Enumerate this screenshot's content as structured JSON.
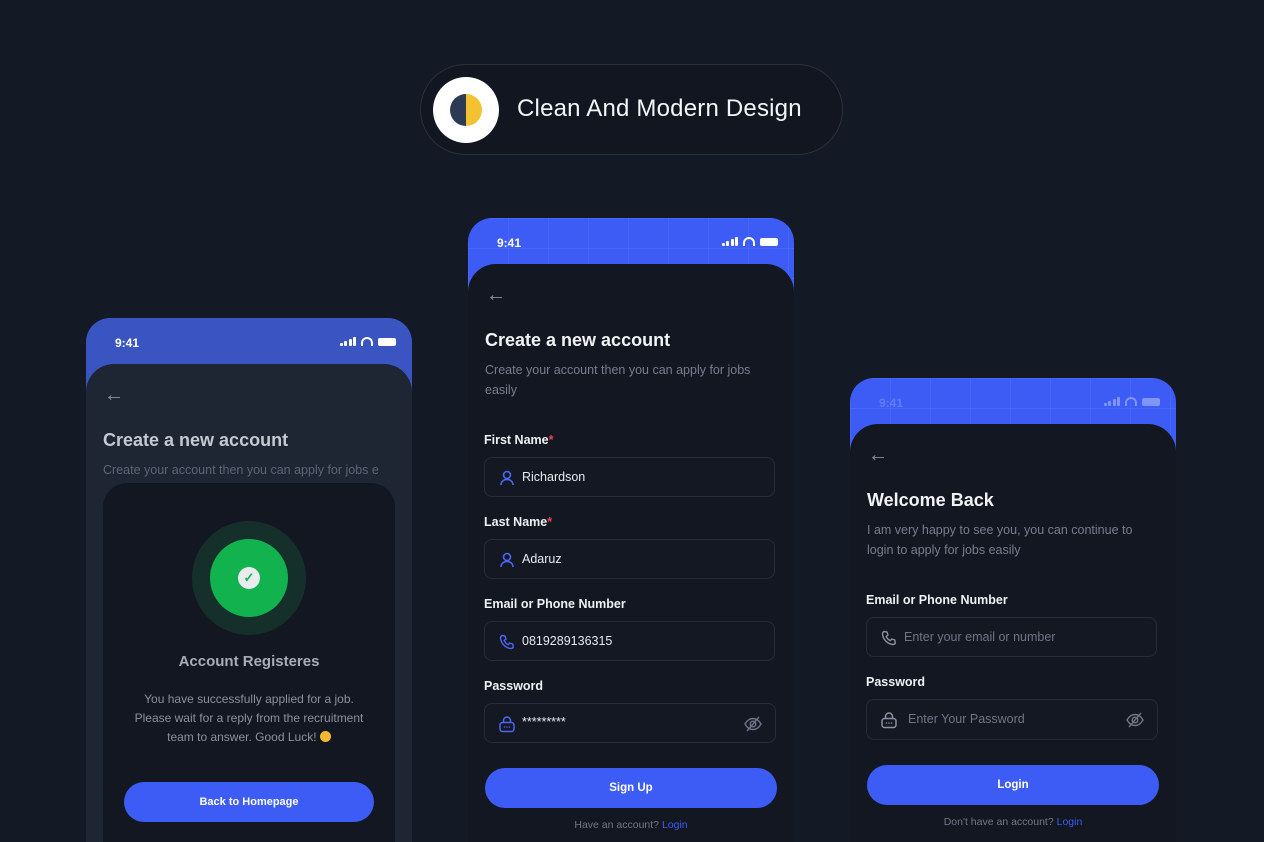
{
  "banner": {
    "title": "Clean And Modern Design",
    "logo_icon": "half-moon-icon"
  },
  "colors": {
    "background": "#141926",
    "accent": "#3c5cf5",
    "success": "#12b34f",
    "required": "#f0425a"
  },
  "status_bar": {
    "time": "9:41"
  },
  "success_screen": {
    "title": "Create a new account",
    "subtitle": "Create your account then you can apply for jobs e",
    "modal": {
      "title": "Account Registeres",
      "line1": "You have successfully applied for a job.",
      "line2": "Please wait for a reply from the recruitment",
      "line3": "team to answer. Good Luck!",
      "button": "Back to Homepage"
    }
  },
  "signup_screen": {
    "title": "Create a new account",
    "subtitle": "Create your account then you can apply for jobs easily",
    "fields": [
      {
        "label": "First Name",
        "required": "*",
        "value": "Richardson",
        "icon": "user-icon"
      },
      {
        "label": "Last Name",
        "required": "*",
        "value": "Adaruz",
        "icon": "user-icon"
      },
      {
        "label": "Email or Phone Number",
        "value": "0819289136315",
        "icon": "phone-icon"
      },
      {
        "label": "Password",
        "value": "*********",
        "icon": "lock-icon"
      }
    ],
    "button": "Sign Up",
    "footer_text": "Have an account?",
    "footer_link": "Login"
  },
  "login_screen": {
    "title": "Welcome Back",
    "subtitle": "I am very happy to see you, you can continue to login to apply for jobs easily",
    "fields": [
      {
        "label": "Email or Phone Number",
        "placeholder": "Enter your email or number",
        "icon": "phone-icon"
      },
      {
        "label": "Password",
        "placeholder": "Enter Your Password",
        "icon": "lock-icon"
      }
    ],
    "button": "Login",
    "footer_text": "Don't have an account?",
    "footer_link": "Login"
  }
}
